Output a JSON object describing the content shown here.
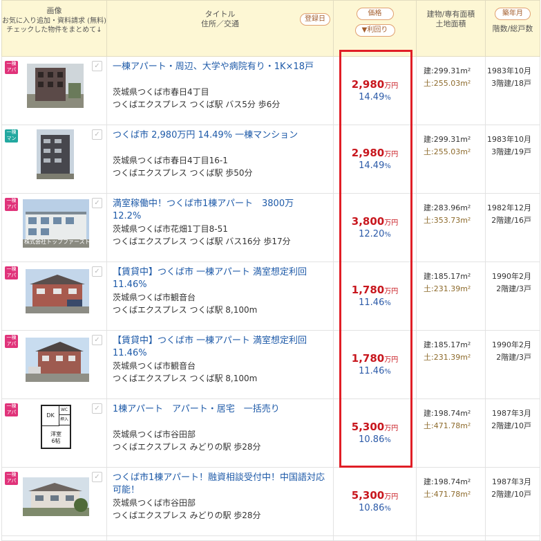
{
  "header": {
    "image_col": "画像",
    "image_note1": "お気に入り追加・資料請求 (無料)",
    "image_note2": "チェックした物件をまとめて↓",
    "title_col": "タイトル",
    "title_sub": "住所／交通",
    "registered_btn": "登録日",
    "price_btn": "価格",
    "yield_sort_btn": "▼利回り",
    "area_col1": "建物/専有面積",
    "area_col2": "土地面積",
    "built_btn": "築年月",
    "floors_col": "階数/総戸数"
  },
  "colors": {
    "accent_red": "#c8171e",
    "yield_blue": "#2b5aa8",
    "highlight": "#e01e26"
  },
  "listings": [
    {
      "badge": "一棟アパート",
      "badge_top": "一棟",
      "badge_bottom": "アパート",
      "badge_color": "pink",
      "title": "一棟アパート・周辺、大学や病院有り・1K×18戸",
      "address": "茨城県つくば市春日4丁目",
      "station": "つくばエクスプレス つくば駅 バス5分 歩6分",
      "price": "2,980",
      "price_unit": "万円",
      "yield": "14.49",
      "building_area": "建:299.31m²",
      "land_area": "土:255.03m²",
      "built": "1983年10月",
      "floors": "3階建/18戸"
    },
    {
      "badge": "一棟マンション",
      "badge_top": "一棟",
      "badge_bottom": "マンション",
      "badge_color": "teal",
      "title": "つくば市 2,980万円 14.49% 一棟マンション",
      "address": "茨城県つくば市春日4丁目16-1",
      "station": "つくばエクスプレス つくば駅 歩50分",
      "price": "2,980",
      "price_unit": "万円",
      "yield": "14.49",
      "building_area": "建:299.31m²",
      "land_area": "土:255.03m²",
      "built": "1983年10月",
      "floors": "3階建/19戸"
    },
    {
      "badge": "一棟アパート",
      "badge_top": "一棟",
      "badge_bottom": "アパート",
      "badge_color": "pink",
      "title": "満室稼働中！つくば市1棟アパート　3800万　12.2%",
      "address": "茨城県つくば市花畑1丁目8-51",
      "station": "つくばエクスプレス つくば駅 バス16分 歩17分",
      "price": "3,800",
      "price_unit": "万円",
      "yield": "12.20",
      "building_area": "建:283.96m²",
      "land_area": "土:353.73m²",
      "built": "1982年12月",
      "floors": "2階建/16戸",
      "photo_caption": "株式会社トップファースト"
    },
    {
      "badge": "一棟アパート",
      "badge_top": "一棟",
      "badge_bottom": "アパート",
      "badge_color": "pink",
      "title": "【賃貸中】つくば市 一棟アパート 満室想定利回11.46%",
      "address": "茨城県つくば市観音台",
      "station": "つくばエクスプレス つくば駅 8,100m",
      "price": "1,780",
      "price_unit": "万円",
      "yield": "11.46",
      "building_area": "建:185.17m²",
      "land_area": "土:231.39m²",
      "built": "1990年2月",
      "floors": "2階建/3戸"
    },
    {
      "badge": "一棟アパート",
      "badge_top": "一棟",
      "badge_bottom": "アパート",
      "badge_color": "pink",
      "title": "【賃貸中】つくば市 一棟アパート 満室想定利回11.46%",
      "address": "茨城県つくば市観音台",
      "station": "つくばエクスプレス つくば駅 8,100m",
      "price": "1,780",
      "price_unit": "万円",
      "yield": "11.46",
      "building_area": "建:185.17m²",
      "land_area": "土:231.39m²",
      "built": "1990年2月",
      "floors": "2階建/3戸"
    },
    {
      "badge": "一棟アパート",
      "badge_top": "一棟",
      "badge_bottom": "アパート",
      "badge_color": "pink",
      "title": "1棟アパート　アパート・居宅　一括売り",
      "address": "茨城県つくば市谷田部",
      "station": "つくばエクスプレス みどりの駅 歩28分",
      "price": "5,300",
      "price_unit": "万円",
      "yield": "10.86",
      "building_area": "建:198.74m²",
      "land_area": "土:471.78m²",
      "built": "1987年3月",
      "floors": "2階建/10戸",
      "floorplan": {
        "dk": "DK",
        "wc": "WC",
        "closet": "押入",
        "room": "洋室",
        "size": "6帖"
      }
    },
    {
      "badge": "一棟アパート",
      "badge_top": "一棟",
      "badge_bottom": "アパート",
      "badge_color": "pink",
      "title": "つくば市1棟アパート！融資相談受付中！中国語対応可能！",
      "address": "茨城県つくば市谷田部",
      "station": "つくばエクスプレス みどりの駅 歩28分",
      "price": "5,300",
      "price_unit": "万円",
      "yield": "10.86",
      "building_area": "建:198.74m²",
      "land_area": "土:471.78m²",
      "built": "1987年3月",
      "floors": "2階建/10戸"
    }
  ]
}
